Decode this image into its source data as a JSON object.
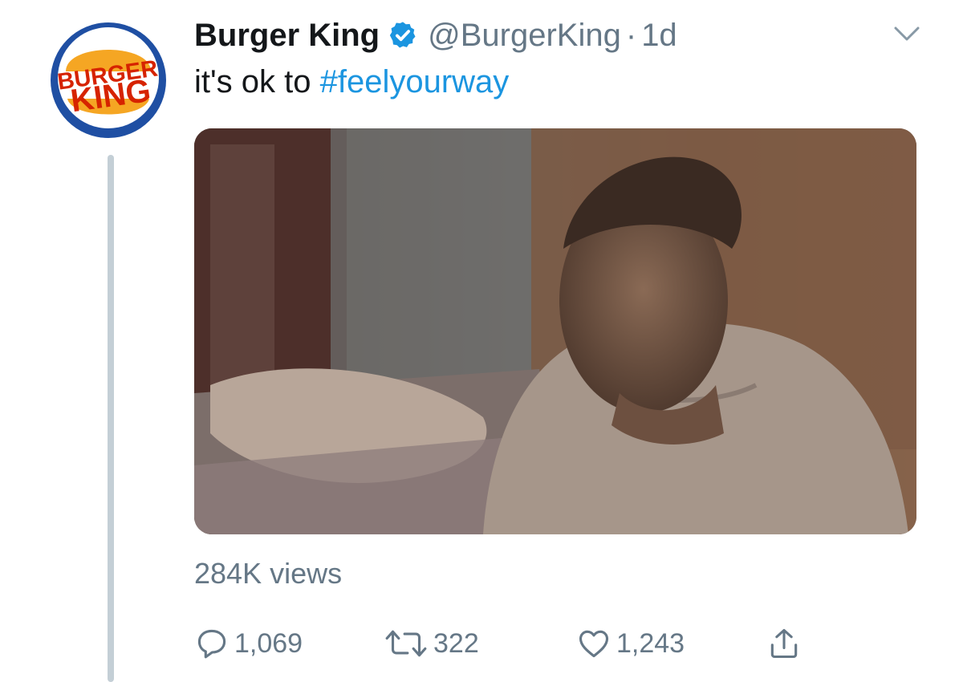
{
  "tweet": {
    "display_name": "Burger King",
    "handle": "@BurgerKing",
    "separator": "·",
    "time": "1d",
    "text_prefix": "it's ok to ",
    "hashtag": "#feelyourway",
    "views": "284K views"
  },
  "actions": {
    "reply_count": "1,069",
    "retweet_count": "322",
    "like_count": "1,243"
  },
  "icons": {
    "avatar": "burger-king-logo",
    "verified": "verified-badge-icon",
    "caret": "chevron-down-icon",
    "reply": "reply-icon",
    "retweet": "retweet-icon",
    "like": "heart-icon",
    "share": "share-icon"
  },
  "logo": {
    "line1": "BURGER",
    "line2": "KING"
  },
  "colors": {
    "link": "#1b95e0",
    "secondary_text": "#657786",
    "primary_text": "#14171a",
    "brand_blue": "#1f4fa3",
    "brand_orange": "#f5a623",
    "brand_red": "#d62300"
  }
}
